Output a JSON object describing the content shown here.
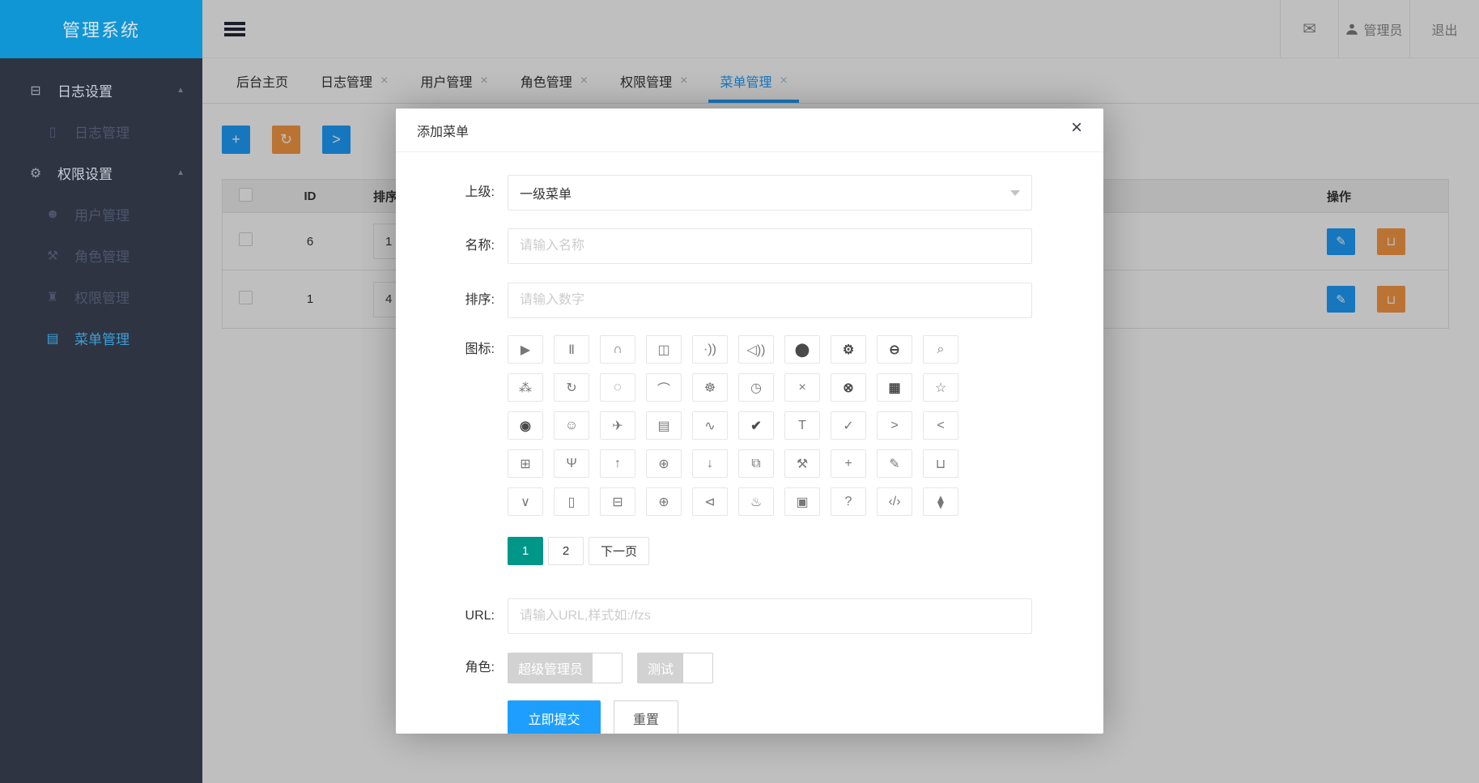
{
  "app": {
    "logo_title": "管理系统"
  },
  "sidebar": {
    "items": [
      {
        "label": "日志设置",
        "glyph": "⊟",
        "arrow": "▲",
        "type": "group",
        "state": "expanded"
      },
      {
        "label": "日志管理",
        "glyph": "▯",
        "type": "sub",
        "state": "dimmed"
      },
      {
        "label": "权限设置",
        "glyph": "⚙",
        "arrow": "▲",
        "type": "group",
        "state": "expanded"
      },
      {
        "label": "用户管理",
        "glyph": "☻",
        "type": "sub",
        "state": "dimmed"
      },
      {
        "label": "角色管理",
        "glyph": "⚒",
        "type": "sub",
        "state": "dimmed"
      },
      {
        "label": "权限管理",
        "glyph": "♜",
        "type": "sub",
        "state": "dimmed"
      },
      {
        "label": "菜单管理",
        "glyph": "▤",
        "type": "sub",
        "state": "active"
      }
    ]
  },
  "topbar": {
    "mail_icon": "✉",
    "username": "管理员",
    "logout": "退出"
  },
  "tabs": {
    "close_icon": "×",
    "items": [
      {
        "label": "后台主页",
        "closable": false
      },
      {
        "label": "日志管理",
        "closable": true
      },
      {
        "label": "用户管理",
        "closable": true
      },
      {
        "label": "角色管理",
        "closable": true
      },
      {
        "label": "权限管理",
        "closable": true
      },
      {
        "label": "菜单管理",
        "closable": true,
        "active": true
      }
    ]
  },
  "toolbar": {
    "add_icon": "+",
    "refresh_icon": "↻",
    "expand_icon": ">"
  },
  "table": {
    "headers": {
      "id": "ID",
      "sort": "排序",
      "actions": "操作"
    },
    "rows": [
      {
        "id": "6",
        "sort": "1"
      },
      {
        "id": "1",
        "sort": "4"
      }
    ],
    "edit_icon": "✎",
    "delete_icon": "⊔"
  },
  "modal": {
    "title": "添加菜单",
    "close_icon": "×",
    "parent_label": "上级:",
    "parent_value": "一级菜单",
    "name_label": "名称:",
    "name_placeholder": "请输入名称",
    "sort_label": "排序:",
    "sort_placeholder": "请输入数字",
    "icon_label": "图标:",
    "url_label": "URL:",
    "url_placeholder": "请输入URL,样式如:/fzs",
    "role_label": "角色:",
    "roles": [
      {
        "label": "超级管理员",
        "checked": false
      },
      {
        "label": "测试",
        "checked": false
      }
    ],
    "pagination": {
      "pages": [
        "1",
        "2"
      ],
      "active": "1",
      "next_label": "下一页"
    },
    "submit_label": "立即提交",
    "reset_label": "重置",
    "icons": [
      {
        "name": "play-circle",
        "glyph": "▶"
      },
      {
        "name": "pause-circle",
        "glyph": "Ⅱ"
      },
      {
        "name": "headphones",
        "glyph": "∩"
      },
      {
        "name": "video",
        "glyph": "◫"
      },
      {
        "name": "voice-signal",
        "glyph": "·))"
      },
      {
        "name": "speaker",
        "glyph": "◁))"
      },
      {
        "name": "chat-dots",
        "glyph": "⬤",
        "filled": true
      },
      {
        "name": "gear-filled",
        "glyph": "⚙",
        "filled": true
      },
      {
        "name": "minus-circle",
        "glyph": "⊖",
        "filled": true
      },
      {
        "name": "search",
        "glyph": "⌕"
      },
      {
        "name": "share-nodes",
        "glyph": "⁂"
      },
      {
        "name": "refresh",
        "glyph": "↻"
      },
      {
        "name": "loading-dots",
        "glyph": "◌"
      },
      {
        "name": "arc",
        "glyph": "⌒"
      },
      {
        "name": "gear-outline",
        "glyph": "☸"
      },
      {
        "name": "clock-arrow",
        "glyph": "◷"
      },
      {
        "name": "close",
        "glyph": "×"
      },
      {
        "name": "close-circle",
        "glyph": "⊗",
        "filled": true
      },
      {
        "name": "presentation-board",
        "glyph": "▦",
        "filled": true
      },
      {
        "name": "star",
        "glyph": "☆"
      },
      {
        "name": "record-oval",
        "glyph": "◉",
        "filled": true
      },
      {
        "name": "smiley-face",
        "glyph": "☺"
      },
      {
        "name": "paper-plane",
        "glyph": "✈"
      },
      {
        "name": "document-text",
        "glyph": "▤"
      },
      {
        "name": "pulse",
        "glyph": "∿"
      },
      {
        "name": "check-circle-filled",
        "glyph": "✔",
        "filled": true
      },
      {
        "name": "t-shirt",
        "glyph": "T"
      },
      {
        "name": "check-circle-outline",
        "glyph": "✓"
      },
      {
        "name": "chevron-right",
        "glyph": ">"
      },
      {
        "name": "chevron-left",
        "glyph": "<"
      },
      {
        "name": "table-grid",
        "glyph": "⊞"
      },
      {
        "name": "palm-tree",
        "glyph": "Ψ"
      },
      {
        "name": "arrow-up-circle",
        "glyph": "↑"
      },
      {
        "name": "plus-circle",
        "glyph": "⊕"
      },
      {
        "name": "arrow-down-circle",
        "glyph": "↓"
      },
      {
        "name": "copy-buildings",
        "glyph": "⧉"
      },
      {
        "name": "tools",
        "glyph": "⚒"
      },
      {
        "name": "plus",
        "glyph": "+"
      },
      {
        "name": "pencil",
        "glyph": "✎"
      },
      {
        "name": "trash",
        "glyph": "⊔"
      },
      {
        "name": "chevron-down",
        "glyph": "∨"
      },
      {
        "name": "file-blank",
        "glyph": "▯"
      },
      {
        "name": "browser-window",
        "glyph": "⊟"
      },
      {
        "name": "plus-circle-thin",
        "glyph": "⊕"
      },
      {
        "name": "chevron-left-circle",
        "glyph": "⊲"
      },
      {
        "name": "fountain",
        "glyph": "♨"
      },
      {
        "name": "image-frame",
        "glyph": "▣"
      },
      {
        "name": "question-mark",
        "glyph": "?"
      },
      {
        "name": "code-circle",
        "glyph": "‹/›"
      },
      {
        "name": "water-drops",
        "glyph": "⧫"
      }
    ]
  },
  "colors": {
    "accent_blue": "#1E9FFF",
    "logo_blue": "#1096D5",
    "sidebar_bg": "#2F3442",
    "sidebar_active": "#3C9FD8",
    "orange": "#FA9A45",
    "pagination_teal": "#009688"
  }
}
